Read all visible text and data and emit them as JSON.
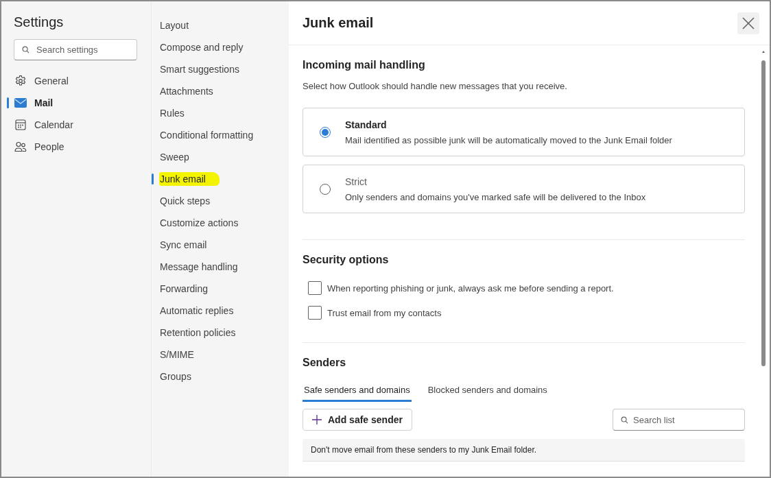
{
  "sidebar": {
    "title": "Settings",
    "search": {
      "placeholder": "Search settings"
    },
    "items": [
      {
        "label": "General",
        "selected": false
      },
      {
        "label": "Mail",
        "selected": true
      },
      {
        "label": "Calendar",
        "selected": false
      },
      {
        "label": "People",
        "selected": false
      }
    ]
  },
  "subnav": {
    "items": [
      {
        "label": "Layout",
        "selected": false,
        "highlighted": false
      },
      {
        "label": "Compose and reply",
        "selected": false,
        "highlighted": false
      },
      {
        "label": "Smart suggestions",
        "selected": false,
        "highlighted": false
      },
      {
        "label": "Attachments",
        "selected": false,
        "highlighted": false
      },
      {
        "label": "Rules",
        "selected": false,
        "highlighted": false
      },
      {
        "label": "Conditional formatting",
        "selected": false,
        "highlighted": false
      },
      {
        "label": "Sweep",
        "selected": false,
        "highlighted": false
      },
      {
        "label": "Junk email",
        "selected": true,
        "highlighted": true
      },
      {
        "label": "Quick steps",
        "selected": false,
        "highlighted": false
      },
      {
        "label": "Customize actions",
        "selected": false,
        "highlighted": false
      },
      {
        "label": "Sync email",
        "selected": false,
        "highlighted": false
      },
      {
        "label": "Message handling",
        "selected": false,
        "highlighted": false
      },
      {
        "label": "Forwarding",
        "selected": false,
        "highlighted": false
      },
      {
        "label": "Automatic replies",
        "selected": false,
        "highlighted": false
      },
      {
        "label": "Retention policies",
        "selected": false,
        "highlighted": false
      },
      {
        "label": "S/MIME",
        "selected": false,
        "highlighted": false
      },
      {
        "label": "Groups",
        "selected": false,
        "highlighted": false
      }
    ]
  },
  "panel": {
    "title": "Junk email",
    "sections": [
      {
        "kind": "radios",
        "title": "Incoming mail handling",
        "description": "Select how Outlook should handle new messages that you receive.",
        "options": [
          {
            "label": "Standard",
            "description": "Mail identified as possible junk will be automatically moved to the Junk Email folder",
            "selected": true
          },
          {
            "label": "Strict",
            "description": "Only senders and domains you've marked safe will be delivered to the Inbox",
            "selected": false
          }
        ]
      },
      {
        "kind": "checkboxes",
        "title": "Security options",
        "options": [
          {
            "label": "When reporting phishing or junk, always ask me before sending a report.",
            "checked": false
          },
          {
            "label": "Trust email from my contacts",
            "checked": false
          }
        ]
      },
      {
        "kind": "senders",
        "title": "Senders",
        "tabs": [
          {
            "label": "Safe senders and domains",
            "selected": true
          },
          {
            "label": "Blocked senders and domains",
            "selected": false
          }
        ],
        "add_button": "Add safe sender",
        "search": {
          "placeholder": "Search list"
        },
        "info": "Don't move email from these senders to my Junk Email folder."
      }
    ]
  }
}
